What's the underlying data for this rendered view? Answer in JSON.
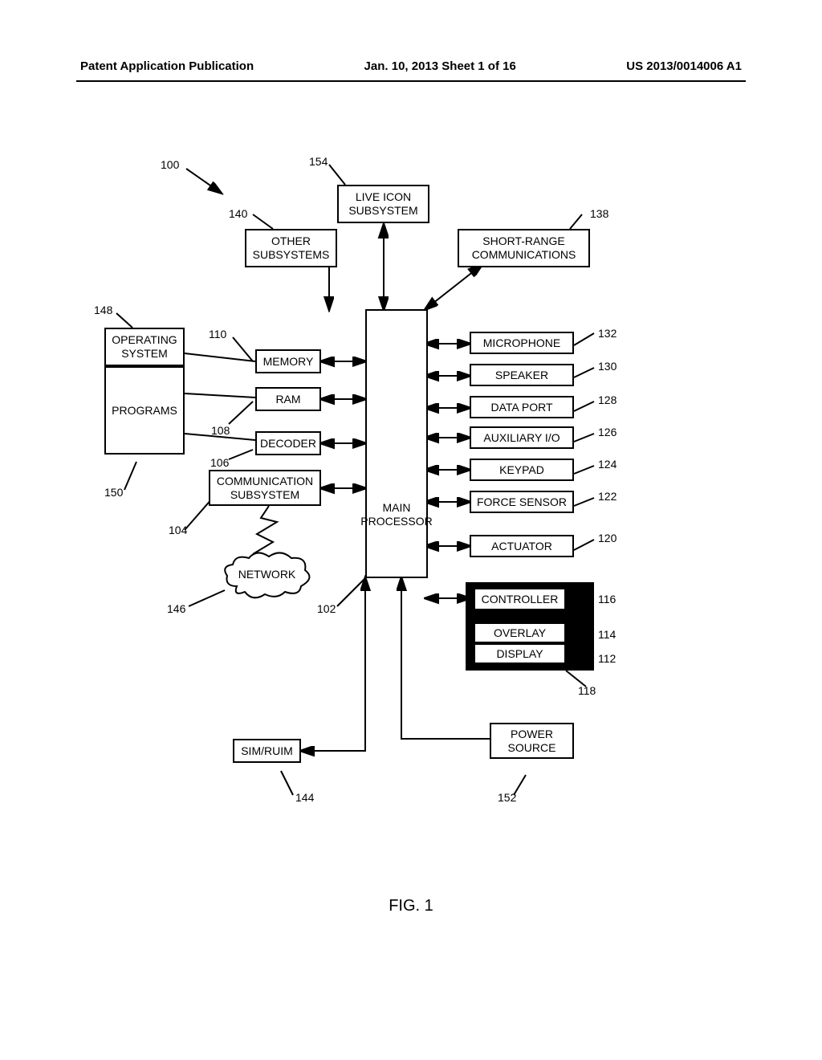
{
  "header": {
    "left": "Patent Application Publication",
    "center": "Jan. 10, 2013  Sheet 1 of 16",
    "right": "US 2013/0014006 A1"
  },
  "figure": {
    "caption": "FIG. 1"
  },
  "refs": {
    "r100": "100",
    "r154": "154",
    "r140": "140",
    "r138": "138",
    "r148": "148",
    "r110": "110",
    "r108": "108",
    "r106": "106",
    "r104": "104",
    "r146": "146",
    "r102": "102",
    "r132": "132",
    "r130": "130",
    "r128": "128",
    "r126": "126",
    "r124": "124",
    "r122": "122",
    "r120": "120",
    "r116": "116",
    "r114": "114",
    "r112": "112",
    "r118": "118",
    "r150": "150",
    "r152": "152",
    "r144": "144"
  },
  "blocks": {
    "live_icon": "LIVE ICON\nSUBSYSTEM",
    "other_sub": "OTHER\nSUBSYSTEMS",
    "short_range": "SHORT-RANGE\nCOMMUNICATIONS",
    "operating_system": "OPERATING\nSYSTEM",
    "programs": "PROGRAMS",
    "memory": "MEMORY",
    "ram": "RAM",
    "decoder": "DECODER",
    "comm_subsystem": "COMMUNICATION\nSUBSYSTEM",
    "main_processor": "MAIN\nPROCESSOR",
    "microphone": "MICROPHONE",
    "speaker": "SPEAKER",
    "data_port": "DATA PORT",
    "aux_io": "AUXILIARY I/O",
    "keypad": "KEYPAD",
    "force_sensor": "FORCE SENSOR",
    "actuator": "ACTUATOR",
    "controller": "CONTROLLER",
    "overlay": "OVERLAY",
    "display": "DISPLAY",
    "power_source": "POWER\nSOURCE",
    "sim_ruim": "SIM/RUIM",
    "network": "NETWORK"
  }
}
